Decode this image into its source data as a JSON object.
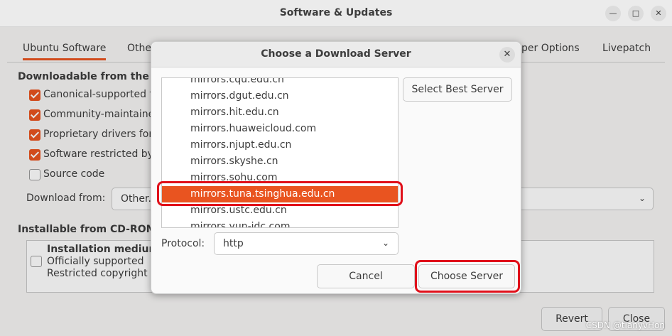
{
  "window": {
    "title": "Software & Updates",
    "minimize_icon": "minimize-icon",
    "maximize_icon": "maximize-icon",
    "close_icon": "close-icon"
  },
  "tabs": [
    {
      "label": "Ubuntu Software",
      "active": true
    },
    {
      "label": "Othe"
    },
    {
      "label": "per Options"
    },
    {
      "label": "Livepatch"
    }
  ],
  "downloadable": {
    "heading": "Downloadable from the In",
    "items": [
      {
        "label": "Canonical-supported fr",
        "checked": true
      },
      {
        "label": "Community-maintained",
        "checked": true
      },
      {
        "label": "Proprietary drivers for",
        "checked": true
      },
      {
        "label": "Software restricted by",
        "checked": true
      },
      {
        "label": "Source code",
        "checked": false
      }
    ]
  },
  "download_from": {
    "label": "Download from:",
    "value": "Other."
  },
  "cdrom": {
    "heading": "Installable from CD-ROM/I",
    "medium_title": "Installation medium",
    "line1": "Officially supported",
    "line2": "Restricted copyright"
  },
  "bottom_buttons": {
    "revert": "Revert",
    "close": "Close"
  },
  "dialog": {
    "title": "Choose a Download Server",
    "close_icon": "close-icon",
    "servers": [
      "mirrors.cqu.edu.cn",
      "mirrors.dgut.edu.cn",
      "mirrors.hit.edu.cn",
      "mirrors.huaweicloud.com",
      "mirrors.njupt.edu.cn",
      "mirrors.skyshe.cn",
      "mirrors.sohu.com",
      "mirrors.tuna.tsinghua.edu.cn",
      "mirrors.ustc.edu.cn",
      "mirrors.yun-idc.com"
    ],
    "selected_index": 7,
    "select_best_label": "Select Best Server",
    "protocol_label": "Protocol:",
    "protocol_value": "http",
    "cancel_label": "Cancel",
    "choose_label": "Choose Server"
  },
  "watermark": "CSDN @tianyvHon",
  "colors": {
    "accent": "#e95420",
    "highlight": "#e0101a"
  }
}
